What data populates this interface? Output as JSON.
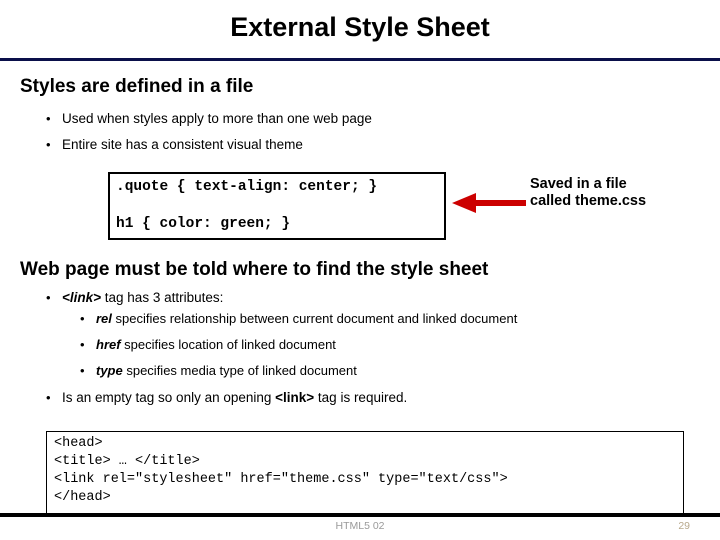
{
  "slide": {
    "title": "External Style Sheet",
    "rule_color": "#0a0f4a"
  },
  "sections": [
    {
      "heading": "Styles are defined in a file",
      "bullets": [
        "Used when styles apply to more than one web page",
        "Entire site has a consistent visual theme"
      ]
    },
    {
      "heading": "Web page must be told where to find the style sheet",
      "bullets": [
        {
          "emphasis": "<link>",
          "rest": " tag has 3 attributes:"
        },
        {
          "emphasis": "rel",
          "rest": " specifies relationship between current document and linked document"
        },
        {
          "emphasis": "href",
          "rest": " specifies location of linked document"
        },
        {
          "emphasis": "type",
          "rest": " specifies media type of linked document"
        },
        {
          "pre": "Is an empty tag so only an opening ",
          "emphasis": "<link>",
          "rest": " tag is required."
        }
      ]
    }
  ],
  "css_code_box": {
    "line1": ".quote { text-align: center; }",
    "line2": "h1 { color: green; }"
  },
  "annotation": {
    "line1": "Saved in a file",
    "line2": "called theme.css",
    "arrow_color": "#cc0000"
  },
  "html_code_box": {
    "line1": "<head>",
    "line2": "<title> … </title>",
    "line3": "<link rel=\"stylesheet\" href=\"theme.css\" type=\"text/css\">",
    "line4": "</head>"
  },
  "footer": {
    "label": "HTML5 02",
    "page_number": "29",
    "label_color": "#9a9a9a",
    "page_color": "#b8a98c"
  },
  "glyphs": {
    "bullet_dot": "•"
  }
}
